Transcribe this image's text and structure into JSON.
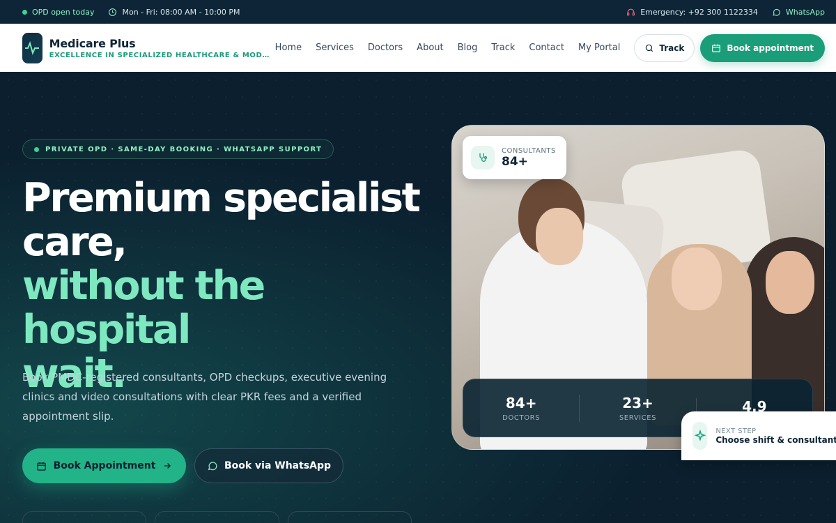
{
  "topbar": {
    "open_status": "OPD open today",
    "hours": "Mon - Fri: 08:00 AM - 10:00 PM",
    "emergency": "Emergency: +92 300 1122334",
    "whatsapp": "WhatsApp"
  },
  "header": {
    "brand_name": "Medicare Plus",
    "brand_tagline": "EXCELLENCE IN SPECIALIZED HEALTHCARE & MODERN …",
    "nav": [
      "Home",
      "Services",
      "Doctors",
      "About",
      "Blog",
      "Track",
      "Contact",
      "My Portal"
    ],
    "track_label": "Track",
    "book_label": "Book appointment"
  },
  "hero": {
    "pill": "PRIVATE OPD · SAME-DAY BOOKING · WHATSAPP SUPPORT",
    "headline_line1": "Premium specialist",
    "headline_line2": "care,",
    "headline_line3": "without the hospital",
    "headline_line4": "wait.",
    "subtext": "Book PMDC-registered consultants, OPD checkups, executive evening clinics and video consultations with clear PKR fees and a verified appointment slip.",
    "cta_primary": "Book Appointment",
    "cta_secondary": "Book via WhatsApp"
  },
  "badge": {
    "label": "CONSULTANTS",
    "value": "84+"
  },
  "stats": [
    {
      "value": "84+",
      "label": "DOCTORS"
    },
    {
      "value": "23+",
      "label": "SERVICES"
    },
    {
      "value": "4.9",
      "label": ""
    }
  ],
  "next_step": {
    "label": "NEXT STEP",
    "value": "Choose shift & consultant"
  },
  "colors": {
    "accent": "#22b389",
    "accent_light": "#7ee8c0",
    "dark": "#0b1f2e"
  }
}
